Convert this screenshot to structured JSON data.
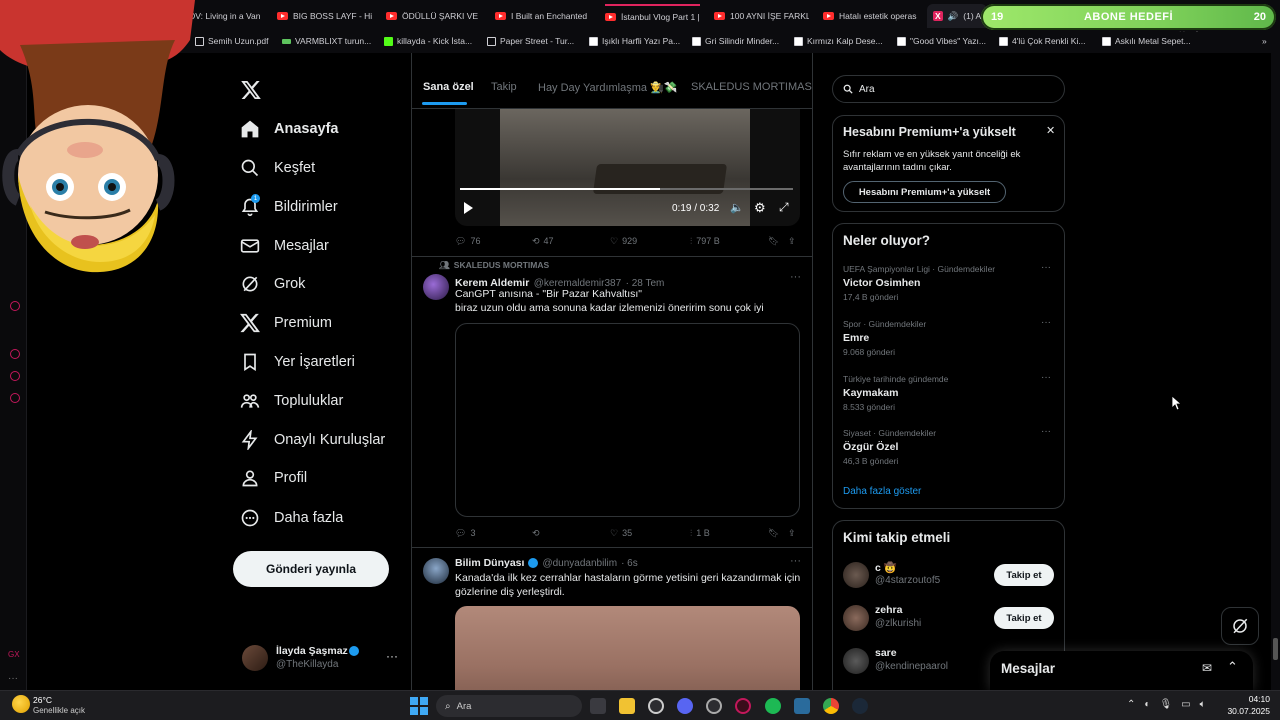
{
  "browser": {
    "tabs": [
      {
        "label": "POV: Living in a Van"
      },
      {
        "label": "BIG BOSS LAYF - Hit"
      },
      {
        "label": "ÖDÜLLÜ ŞARKI VE K"
      },
      {
        "label": "I Built an Enchanted"
      },
      {
        "label": "İstanbul Vlog Part 1 |"
      },
      {
        "label": "100 AYNI İŞE FARKLI"
      },
      {
        "label": "Hatalı estetik operas"
      },
      {
        "label": "(1) A"
      }
    ],
    "bookmarks": [
      {
        "label": "Semih Uzun.pdf"
      },
      {
        "label": "VARMBLIXT turun..."
      },
      {
        "label": "killayda - Kick İsta..."
      },
      {
        "label": "Paper Street - Tur..."
      },
      {
        "label": "Işıklı Harfli Yazı Pa..."
      },
      {
        "label": "Gri Silindir Minder..."
      },
      {
        "label": "Kırmızı Kalp Dese..."
      },
      {
        "label": "\"Good Vibes\" Yazı..."
      },
      {
        "label": "4'lü Çok Renkli Ki..."
      },
      {
        "label": "Askılı Metal Sepet..."
      }
    ]
  },
  "abone": {
    "left": "19",
    "label": "ABONE HEDEFİ",
    "right": "20"
  },
  "nav": {
    "items": [
      {
        "label": "Anasayfa"
      },
      {
        "label": "Keşfet"
      },
      {
        "label": "Bildirimler"
      },
      {
        "label": "Mesajlar"
      },
      {
        "label": "Grok"
      },
      {
        "label": "Premium"
      },
      {
        "label": "Yer İşaretleri"
      },
      {
        "label": "Topluluklar"
      },
      {
        "label": "Onaylı Kuruluşlar"
      },
      {
        "label": "Profil"
      },
      {
        "label": "Daha fazla"
      }
    ],
    "notification_badge": "1",
    "post_button": "Gönderi yayınla",
    "profile": {
      "name": "İlayda Şaşmaz",
      "handle": "@TheKillayda",
      "more": "···"
    }
  },
  "feed": {
    "tabs": [
      "Sana özel",
      "Takip",
      "Hay Day Yardımlaşma 👨‍🌾💸",
      "SKALEDUS MORTIMAS"
    ],
    "video": {
      "time": "0:19 / 0:32",
      "progress": 0.6
    },
    "tweet1_actions": {
      "replies": "76",
      "retweets": "47",
      "likes": "929",
      "views": "797 B"
    },
    "tweet2": {
      "context": "SKALEDUS MORTIMAS",
      "name": "Kerem Aldemir",
      "handle": "@keremaldemir387",
      "time": "· 28 Tem",
      "line1": "CanGPT anısına - \"Bir Pazar Kahvaltısı\"",
      "line2": "biraz uzun oldu ama sonuna kadar izlemenizi öneririm sonu çok iyi",
      "actions": {
        "replies": "3",
        "retweets": "",
        "likes": "35",
        "views": "1 B"
      }
    },
    "tweet3": {
      "name": "Bilim Dünyası",
      "handle": "@dunyadanbilim",
      "time": "· 6s",
      "line1": "Kanada'da ilk kez cerrahlar hastaların görme yetisini geri kazandırmak için",
      "line2": "gözlerine diş yerleştirdi."
    }
  },
  "right": {
    "search_placeholder": "Ara",
    "premium": {
      "title": "Hesabını Premium+'a yükselt",
      "line1": "Sıfır reklam ve en yüksek yanıt önceliği ek",
      "line2": "avantajlarının tadını çıkar.",
      "button": "Hesabını Premium+'a yükselt"
    },
    "trends_title": "Neler oluyor?",
    "trends": [
      {
        "meta": "UEFA Şampiyonlar Ligi · Gündemdekiler",
        "name": "Victor Osimhen",
        "count": "17,4 B gönderi"
      },
      {
        "meta": "Spor · Gündemdekiler",
        "name": "Emre",
        "count": "9.068 gönderi"
      },
      {
        "meta": "Türkiye tarihinde gündemde",
        "name": "Kaymakam",
        "count": "8.533 gönderi"
      },
      {
        "meta": "Siyaset · Gündemdekiler",
        "name": "Özgür Özel",
        "count": "46,3 B gönderi"
      }
    ],
    "show_more": "Daha fazla göster",
    "who_title": "Kimi takip etmeli",
    "who": [
      {
        "name": "c 🤠",
        "handle": "@4starzoutof5",
        "button": "Takip et"
      },
      {
        "name": "zehra",
        "handle": "@zlkurishi",
        "button": "Takip et"
      },
      {
        "name": "sare",
        "handle": "@kendinepaarol",
        "button": ""
      }
    ],
    "messages_title": "Mesajlar"
  },
  "taskbar": {
    "weather_temp": "26°C",
    "weather_desc": "Genellikle açık",
    "search": "Ara",
    "time": "04:10",
    "date": "30.07.2025"
  }
}
